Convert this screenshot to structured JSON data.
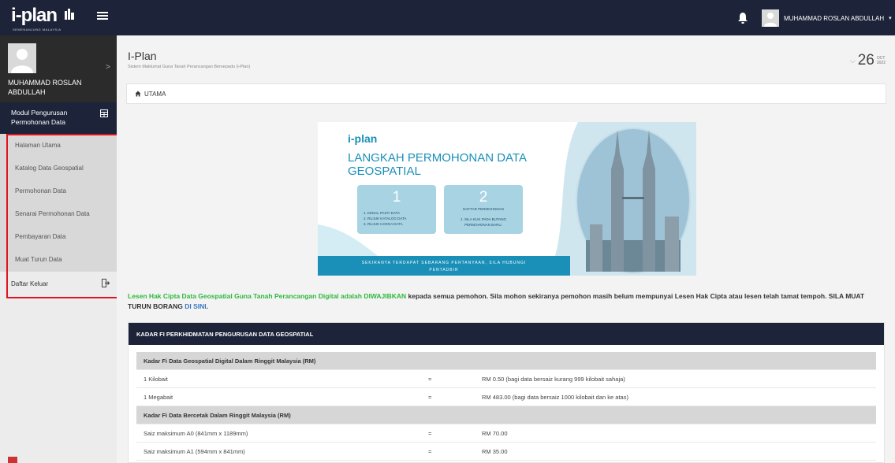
{
  "header": {
    "logo_text": "i-plan",
    "logo_subtext": "SEMENANJUNG MALAYSIA",
    "user_name": "MUHAMMAD ROSLAN ABDULLAH",
    "user_caret": "▾"
  },
  "sidebar": {
    "user_name": "MUHAMMAD ROSLAN ABDULLAH",
    "user_chevron": ">",
    "module_title": "Modul Pengurusan Permohonan Data",
    "items": [
      {
        "label": "Halaman Utama"
      },
      {
        "label": "Katalog Data Geospatial"
      },
      {
        "label": "Permohonan Data"
      },
      {
        "label": "Senarai Permohonan Data"
      },
      {
        "label": "Pembayaran Data"
      },
      {
        "label": "Muat Turun Data"
      }
    ],
    "logout_label": "Daftar Keluar",
    "highlight_color": "#e0141e"
  },
  "page": {
    "title": "I-Plan",
    "subtitle": "Sistem Maklumat Guna Tanah Perancangan Bersepadu (i-Plan)",
    "date_day": "26",
    "date_month": "OCT",
    "date_year": "2022",
    "breadcrumb": "UTAMA"
  },
  "banner": {
    "logo": "i-plan",
    "title_line1": "LANGKAH PERMOHONAN DATA",
    "title_line2": "GEOSPATIAL",
    "step1_number": "1",
    "step1_lines": [
      "1.   KENAL PASTI DATA",
      "2.  RUJUK KATALOG DATA",
      "3.   RUJUK HARGA DATA"
    ],
    "step2_number": "2",
    "step2_title": "DAFTAR PERMOHONAN",
    "step2_lines": [
      "1. SILA KLIK PADA BUTANG",
      "PERMOHONAN BARU."
    ],
    "footer_line1": "SEKIRANYA TERDAPAT SEBARANG PERTANYAAN, SILA HUBUNGI",
    "footer_line2": "PENTADBIR",
    "accent_color": "#1a8fb8"
  },
  "notice": {
    "green_text": "Lesen Hak Cipta Data Geospatial Guna Tanah Perancangan Digital adalah DIWAJIBKAN",
    "body_text": " kepada semua pemohon. Sila mohon sekiranya pemohon masih belum mempunyai Lesen Hak Cipta atau lesen telah tamat tempoh. SILA MUAT TURUN BORANG ",
    "link_text": "DI SINI",
    "end_text": "."
  },
  "fee_table": {
    "header": "KADAR FI PERKHIDMATAN PENGURUSAN DATA GEOSPATIAL",
    "rows": [
      {
        "type": "section",
        "item": "Kadar Fi Data Geospatial Digital Dalam Ringgit Malaysia (RM)",
        "eq": "",
        "value": ""
      },
      {
        "type": "row",
        "item": "1 Kilobait",
        "eq": "=",
        "value": "RM 0.50 (bagi data bersaiz kurang 999 kilobait sahaja)"
      },
      {
        "type": "row",
        "item": "1 Megabait",
        "eq": "=",
        "value": "RM 483.00 (bagi data bersaiz 1000 kilobait dan ke atas)"
      },
      {
        "type": "section",
        "item": "Kadar Fi Data Bercetak Dalam Ringgit Malaysia (RM)",
        "eq": "",
        "value": ""
      },
      {
        "type": "row",
        "item": "Saiz maksimum A0 (841mm x 1189mm)",
        "eq": "=",
        "value": "RM 70.00"
      },
      {
        "type": "row",
        "item": "Saiz maksimum A1 (594mm x 841mm)",
        "eq": "=",
        "value": "RM 35.00"
      }
    ]
  }
}
